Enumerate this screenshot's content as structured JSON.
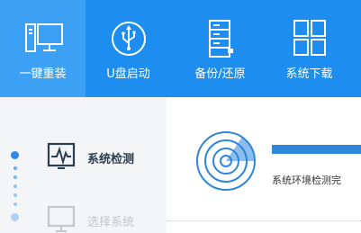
{
  "nav": {
    "items": [
      {
        "label": "一键重装",
        "icon": "monitor-icon",
        "active": true
      },
      {
        "label": "U盘启动",
        "icon": "usb-icon",
        "active": false
      },
      {
        "label": "备份/还原",
        "icon": "backup-icon",
        "active": false
      },
      {
        "label": "系统下载",
        "icon": "grid-icon",
        "active": false
      }
    ]
  },
  "steps": {
    "items": [
      {
        "label": "系统检测",
        "icon": "pulse-monitor-icon",
        "state": "current"
      },
      {
        "label": "选择系统",
        "icon": "monitor-icon",
        "state": "pending"
      }
    ]
  },
  "main": {
    "status_text": "系统环境检测完",
    "progress_percent": 100
  },
  "colors": {
    "topbar": "#1d8ef0",
    "nav_active": "#3ca0f5",
    "accent": "#2f86dc",
    "sidebar": "#f3f5f7"
  }
}
